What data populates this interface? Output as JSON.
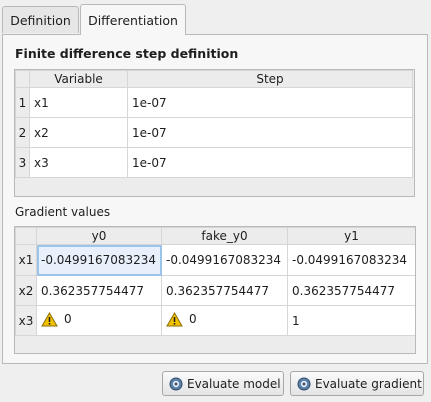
{
  "tabs": [
    "Definition",
    "Differentiation"
  ],
  "active_tab": "Differentiation",
  "step_section": {
    "title": "Finite difference step definition",
    "columns": [
      "Variable",
      "Step"
    ],
    "rows": [
      {
        "num": "1",
        "variable": "x1",
        "step": "1e-07"
      },
      {
        "num": "2",
        "variable": "x2",
        "step": "1e-07"
      },
      {
        "num": "3",
        "variable": "x3",
        "step": "1e-07"
      }
    ]
  },
  "gradient_section": {
    "title": "Gradient values",
    "columns": [
      "y0",
      "fake_y0",
      "y1"
    ],
    "rows": [
      {
        "label": "x1",
        "cells": [
          "-0.0499167083234",
          "-0.0499167083234",
          "-0.0499167083234"
        ]
      },
      {
        "label": "x2",
        "cells": [
          "0.362357754477",
          "0.362357754477",
          "0.362357754477"
        ]
      },
      {
        "label": "x3",
        "cells": [
          "0",
          "0",
          "1"
        ]
      }
    ],
    "warning_cells": [
      "x3.y0",
      "x3.fake_y0"
    ]
  },
  "buttons": {
    "evaluate_model": "Evaluate model",
    "evaluate_gradient": "Evaluate gradient"
  },
  "colors": {
    "warning": "#f2c200",
    "selection": "#9cc3ea"
  }
}
